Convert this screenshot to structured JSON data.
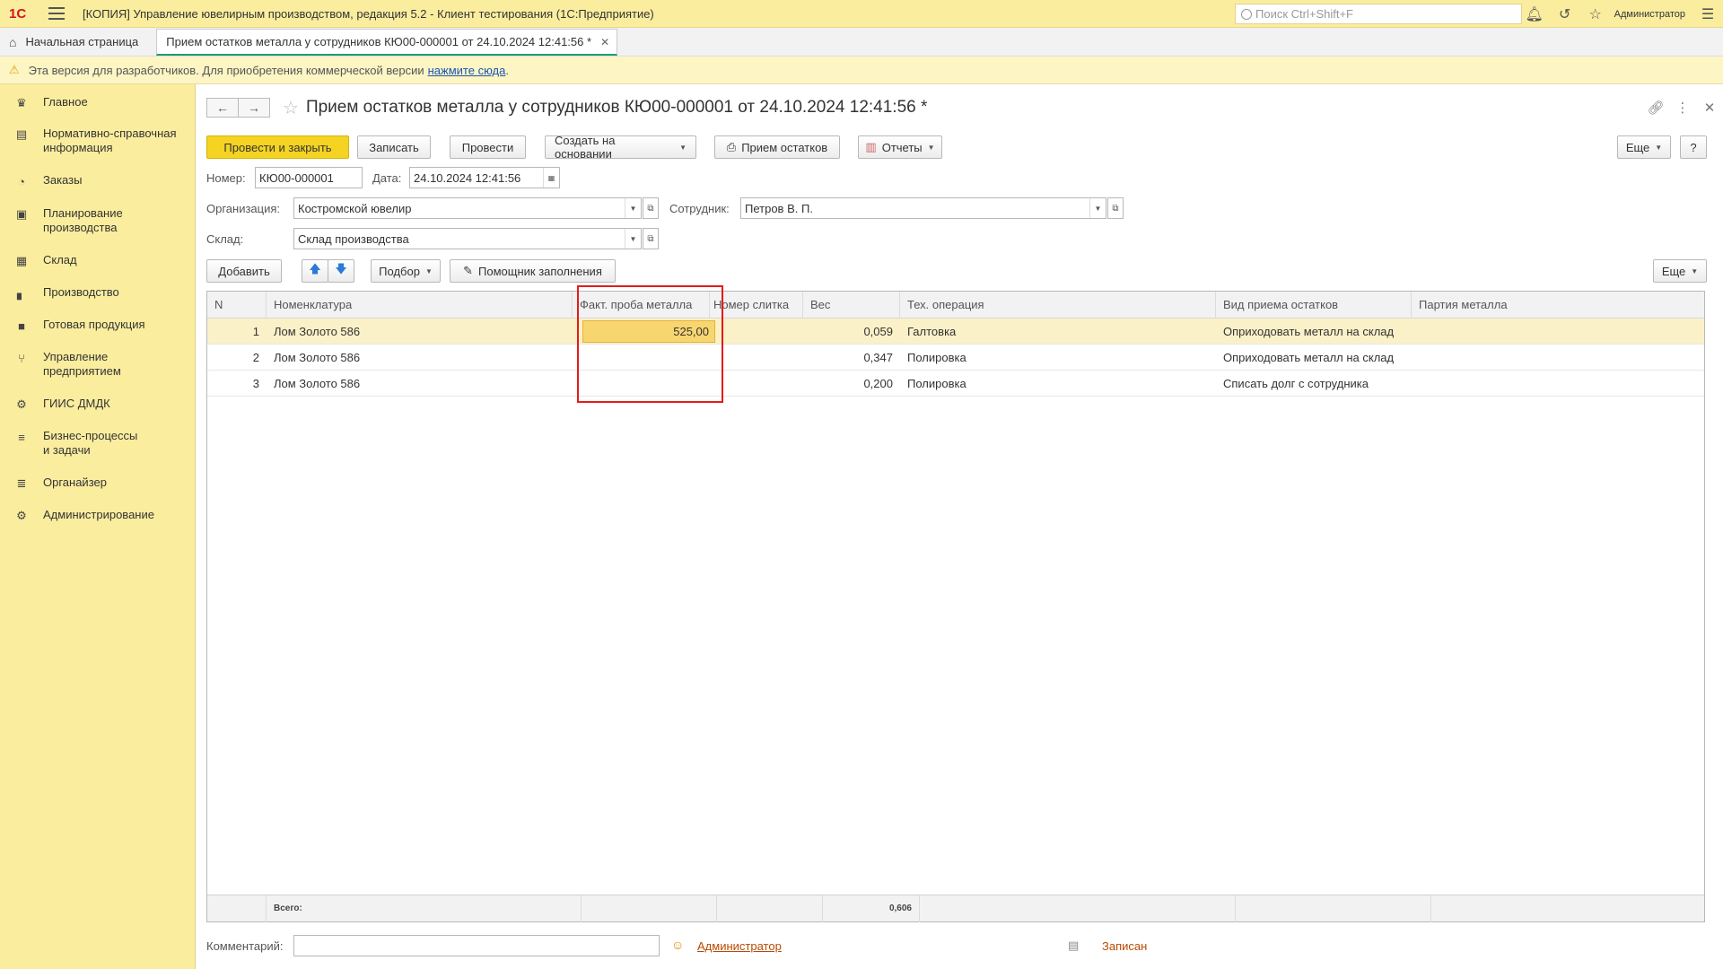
{
  "titlebar": {
    "logo": "1С",
    "title": "[КОПИЯ] Управление ювелирным производством, редакция 5.2  - Клиент тестирования (1С:Предприятие)",
    "search_placeholder": "Поиск Ctrl+Shift+F",
    "user": "Администратор"
  },
  "tabs": {
    "home": "Начальная страница",
    "doc": "Прием остатков металла у сотрудников КЮ00-000001 от 24.10.2024 12:41:56 *"
  },
  "devbar": {
    "text": "Эта версия для разработчиков. Для приобретения коммерческой версии",
    "link": "нажмите сюда",
    "tail": "."
  },
  "sidebar": {
    "items": [
      {
        "label": "Главное",
        "icon": "crown-icon"
      },
      {
        "label": "Нормативно-справочная информация",
        "icon": "books-icon"
      },
      {
        "label": "Заказы",
        "icon": "pie-icon"
      },
      {
        "label": "Планирование производства",
        "icon": "clipboard-icon"
      },
      {
        "label": "Склад",
        "icon": "grid-icon"
      },
      {
        "label": "Производство",
        "icon": "factory-icon"
      },
      {
        "label": "Готовая продукция",
        "icon": "bag-icon"
      },
      {
        "label": "Управление предприятием",
        "icon": "org-icon"
      },
      {
        "label": "ГИИС ДМДК",
        "icon": "gear-link-icon"
      },
      {
        "label": "Бизнес-процессы и задачи",
        "icon": "tasks-icon"
      },
      {
        "label": "Органайзер",
        "icon": "sliders-icon"
      },
      {
        "label": "Администрирование",
        "icon": "gear-icon"
      }
    ]
  },
  "document": {
    "title": "Прием остатков металла у сотрудников КЮ00-000001 от 24.10.2024 12:41:56 *",
    "toolbar": {
      "post_close": "Провести и закрыть",
      "save": "Записать",
      "post": "Провести",
      "create_based": "Создать на основании",
      "receipt": "Прием остатков",
      "reports": "Отчеты",
      "more": "Еще",
      "help": "?"
    },
    "fields": {
      "number_label": "Номер:",
      "number": "КЮ00-000001",
      "date_label": "Дата:",
      "date": "24.10.2024 12:41:56",
      "org_label": "Организация:",
      "org": "Костромской ювелир",
      "employee_label": "Сотрудник:",
      "employee": "Петров В. П.",
      "warehouse_label": "Склад:",
      "warehouse": "Склад производства"
    },
    "table_toolbar": {
      "add": "Добавить",
      "pick": "Подбор",
      "fill_helper": "Помощник заполнения",
      "more": "Еще"
    },
    "table": {
      "columns": [
        "N",
        "Номенклатура",
        "Факт. проба металла",
        "Номер слитка",
        "Вес",
        "Тех. операция",
        "Вид приема остатков",
        "Партия металла"
      ],
      "rows": [
        {
          "n": "1",
          "item": "Лом Золото  586",
          "probe": "525,00",
          "ingot": "",
          "weight": "0,059",
          "operation": "Галтовка",
          "kind": "Оприходовать металл на склад",
          "batch": ""
        },
        {
          "n": "2",
          "item": "Лом Золото  586",
          "probe": "",
          "ingot": "",
          "weight": "0,347",
          "operation": "Полировка",
          "kind": "Оприходовать металл на склад",
          "batch": ""
        },
        {
          "n": "3",
          "item": "Лом Золото  586",
          "probe": "",
          "ingot": "",
          "weight": "0,200",
          "operation": "Полировка",
          "kind": "Списать долг с сотрудника",
          "batch": ""
        }
      ],
      "footer": {
        "total_label": "Всего:",
        "total_weight": "0,606"
      }
    },
    "bottom": {
      "comment_label": "Комментарий:",
      "comment": "",
      "author": "Администратор",
      "status": "Записан"
    }
  },
  "colors": {
    "accent": "#f4d322",
    "sidebar": "#fbed9e",
    "highlight": "#e31b1b",
    "link": "#1a55b3"
  }
}
